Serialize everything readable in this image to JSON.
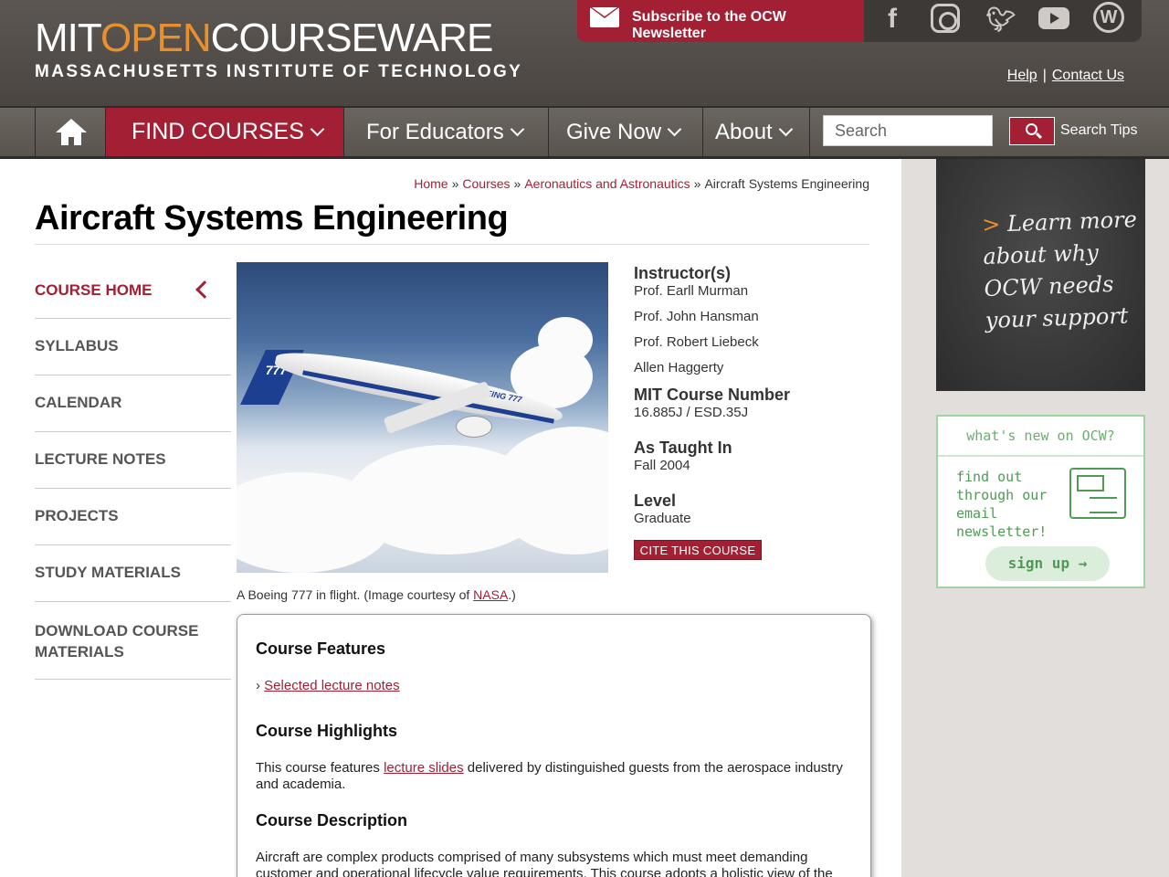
{
  "header": {
    "logo": {
      "mit": "MIT",
      "open": "OPEN",
      "courseware": "COURSEWARE",
      "subtitle": "MASSACHUSETTS INSTITUTE OF TECHNOLOGY"
    },
    "subscribe_label": "Subscribe to the OCW Newsletter",
    "social_icons": [
      "facebook-icon",
      "instagram-icon",
      "twitter-icon",
      "youtube-icon",
      "wordpress-icon"
    ],
    "help_label": "Help",
    "contact_label": "Contact Us"
  },
  "nav": {
    "find_courses": "FIND COURSES",
    "for_educators": "For Educators",
    "give_now": "Give Now",
    "about": "About",
    "search_placeholder": "Search",
    "search_tips": "Search Tips"
  },
  "breadcrumb": {
    "home": "Home",
    "courses": "Courses",
    "department": "Aeronautics and Astronautics",
    "current": "Aircraft Systems Engineering",
    "separator": "»"
  },
  "page": {
    "title": "Aircraft Systems Engineering"
  },
  "sidebar": {
    "items": [
      {
        "label": "COURSE HOME",
        "active": true
      },
      {
        "label": "SYLLABUS"
      },
      {
        "label": "CALENDAR"
      },
      {
        "label": "LECTURE NOTES"
      },
      {
        "label": "PROJECTS"
      },
      {
        "label": "STUDY MATERIALS"
      },
      {
        "label": "DOWNLOAD COURSE MATERIALS"
      }
    ]
  },
  "image": {
    "caption_prefix": "A Boeing 777 in flight. (Image courtesy of ",
    "caption_link": "NASA",
    "caption_suffix": ".)",
    "tail_text": "777",
    "fuselage_text": "BOEING 777"
  },
  "course_info": {
    "instructors_heading": "Instructor(s)",
    "instructors": [
      "Prof. Earll Murman",
      "Prof. John Hansman",
      "Prof. Robert Liebeck",
      "Allen Haggerty"
    ],
    "course_number_heading": "MIT Course Number",
    "course_number": "16.885J / ESD.35J",
    "taught_heading": "As Taught In",
    "taught": "Fall 2004",
    "level_heading": "Level",
    "level": "Graduate",
    "cite_button": "CITE THIS COURSE"
  },
  "features": {
    "features_heading": "Course Features",
    "features_link": "Selected lecture notes",
    "highlights_heading": "Course Highlights",
    "highlights_prefix": "This course features ",
    "highlights_link": "lecture slides",
    "highlights_suffix": " delivered by distinguished guests from the aerospace industry and academia.",
    "description_heading": "Course Description",
    "description": "Aircraft are complex products comprised of many subsystems which must meet demanding customer and operational lifecycle value requirements. This course adopts a holistic view of the"
  },
  "right_rail": {
    "chalk_arrow": ">",
    "chalk_text": "Learn more about why OCW needs your support",
    "newsletter_heading": "what's new on OCW?",
    "newsletter_text": "find out through our email newsletter!",
    "newsletter_button": "sign up →"
  },
  "colors": {
    "brand_red": "#a31f34",
    "header_gray": "#4a4541",
    "accent_orange": "#e8902e",
    "newsletter_green": "#4f9b55"
  }
}
